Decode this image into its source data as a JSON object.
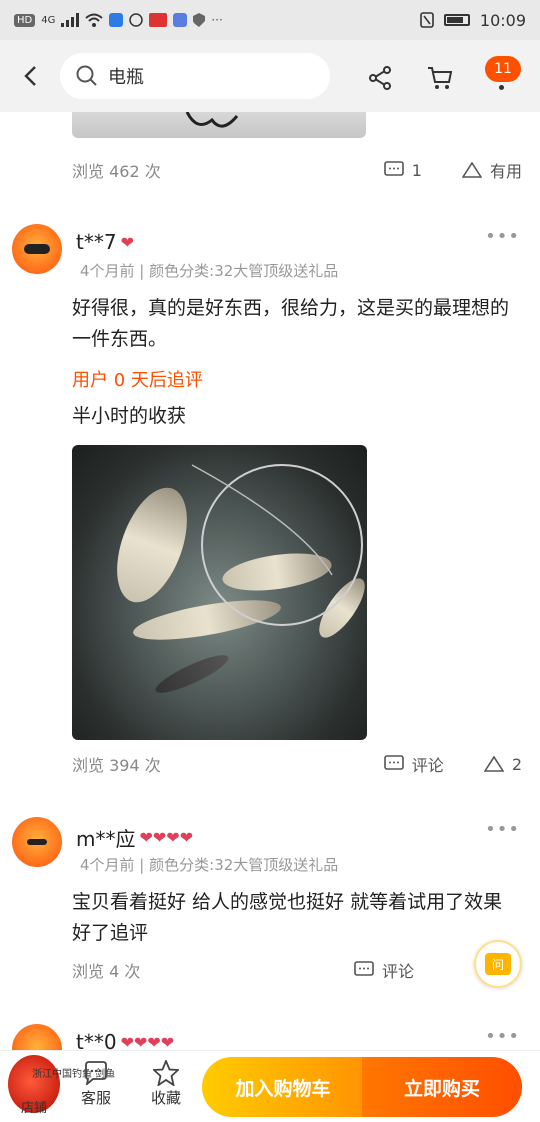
{
  "status": {
    "time": "10:09",
    "left_icons": [
      "HD",
      "4G"
    ]
  },
  "header": {
    "search_placeholder": "电瓶",
    "cart_badge": "11"
  },
  "prev_review": {
    "views": "浏览 462 次",
    "comment_count": "1",
    "useful_label": "有用"
  },
  "reviews": [
    {
      "user": "t**7",
      "meta": "4个月前 | 颜色分类:32大管顶级送礼品",
      "text": "好得很，真的是好东西，很给力，这是买的最理想的一件东西。",
      "append_label": "用户 0 天后追评",
      "append_text": "半小时的收获",
      "views": "浏览 394 次",
      "comment_label": "评论",
      "like_count": "2"
    },
    {
      "user": "m**应",
      "meta": "4个月前 | 颜色分类:32大管顶级送礼品",
      "text": "宝贝看着挺好  给人的感觉也挺好  就等着试用了效果好了追评",
      "views": "浏览 4 次",
      "comment_label": "评论"
    },
    {
      "user": "t**0"
    }
  ],
  "more_dots": "•••",
  "float_label": "问",
  "bottom": {
    "shop_label": "店铺",
    "service_label": "客服",
    "fav_label": "收藏",
    "cart_button": "加入购物车",
    "buy_button": "立即购买",
    "watermark": "浙江中国钓鱼 剑鱼"
  }
}
